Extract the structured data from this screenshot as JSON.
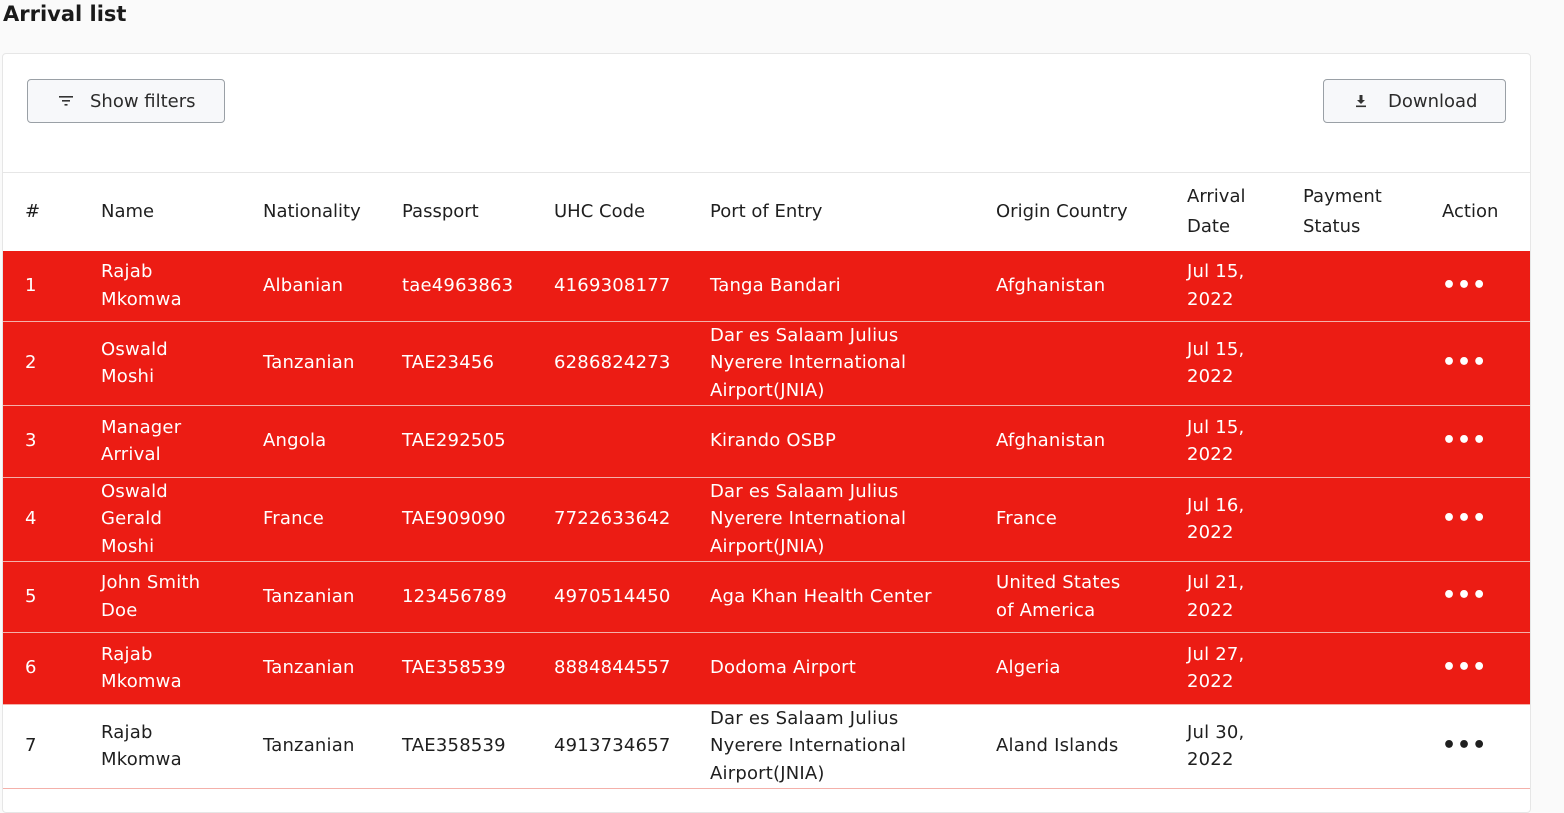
{
  "page": {
    "title": "Arrival list"
  },
  "toolbar": {
    "filters_label": "Show filters",
    "filters_icon": "filter-icon",
    "download_label": "Download",
    "download_icon": "download-icon"
  },
  "table": {
    "columns": {
      "num": "#",
      "name": "Name",
      "nationality": "Nationality",
      "passport": "Passport",
      "uhc": "UHC Code",
      "port": "Port of Entry",
      "origin": "Origin Country",
      "arrival_1": "Arrival",
      "arrival_2": "Date",
      "payment_1": "Payment",
      "payment_2": "Status",
      "action": "Action"
    },
    "rows": [
      {
        "num": "1",
        "name_lines": [
          "Rajab",
          "Mkomwa"
        ],
        "nationality": "Albanian",
        "passport": "tae4963863",
        "uhc": "4169308177",
        "port_lines": [
          "Tanga Bandari"
        ],
        "origin_lines": [
          "Afghanistan"
        ],
        "date_lines": [
          "Jul 15,",
          "2022"
        ],
        "payment": "",
        "action": "•••",
        "flagged": true
      },
      {
        "num": "2",
        "name_lines": [
          "Oswald",
          "Moshi"
        ],
        "nationality": "Tanzanian",
        "passport": "TAE23456",
        "uhc": "6286824273",
        "port_lines": [
          "Dar es Salaam Julius",
          "Nyerere International",
          "Airport(JNIA)"
        ],
        "origin_lines": [],
        "date_lines": [
          "Jul 15,",
          "2022"
        ],
        "payment": "",
        "action": "•••",
        "flagged": true
      },
      {
        "num": "3",
        "name_lines": [
          "Manager",
          "Arrival"
        ],
        "nationality": "Angola",
        "passport": "TAE292505",
        "uhc": "",
        "port_lines": [
          "Kirando OSBP"
        ],
        "origin_lines": [
          "Afghanistan"
        ],
        "date_lines": [
          "Jul 15,",
          "2022"
        ],
        "payment": "",
        "action": "•••",
        "flagged": true
      },
      {
        "num": "4",
        "name_lines": [
          "Oswald",
          "Gerald",
          "Moshi"
        ],
        "nationality": "France",
        "passport": "TAE909090",
        "uhc": "7722633642",
        "port_lines": [
          "Dar es Salaam Julius",
          "Nyerere International",
          "Airport(JNIA)"
        ],
        "origin_lines": [
          "France"
        ],
        "date_lines": [
          "Jul 16,",
          "2022"
        ],
        "payment": "",
        "action": "•••",
        "flagged": true
      },
      {
        "num": "5",
        "name_lines": [
          "John Smith",
          "Doe"
        ],
        "nationality": "Tanzanian",
        "passport": "123456789",
        "uhc": "4970514450",
        "port_lines": [
          "Aga Khan Health Center"
        ],
        "origin_lines": [
          "United States",
          "of America"
        ],
        "date_lines": [
          "Jul 21,",
          "2022"
        ],
        "payment": "",
        "action": "•••",
        "flagged": true
      },
      {
        "num": "6",
        "name_lines": [
          "Rajab",
          "Mkomwa"
        ],
        "nationality": "Tanzanian",
        "passport": "TAE358539",
        "uhc": "8884844557",
        "port_lines": [
          "Dodoma Airport"
        ],
        "origin_lines": [
          "Algeria"
        ],
        "date_lines": [
          "Jul 27,",
          "2022"
        ],
        "payment": "",
        "action": "•••",
        "flagged": true
      },
      {
        "num": "7",
        "name_lines": [
          "Rajab",
          "Mkomwa"
        ],
        "nationality": "Tanzanian",
        "passport": "TAE358539",
        "uhc": "4913734657",
        "port_lines": [
          "Dar es Salaam Julius",
          "Nyerere International",
          "Airport(JNIA)"
        ],
        "origin_lines": [
          "Aland Islands"
        ],
        "date_lines": [
          "Jul 30,",
          "2022"
        ],
        "payment": "",
        "action": "•••",
        "flagged": false
      }
    ]
  },
  "colors": {
    "flagged_row": "#ec1c14",
    "normal_row": "#ffffff"
  }
}
